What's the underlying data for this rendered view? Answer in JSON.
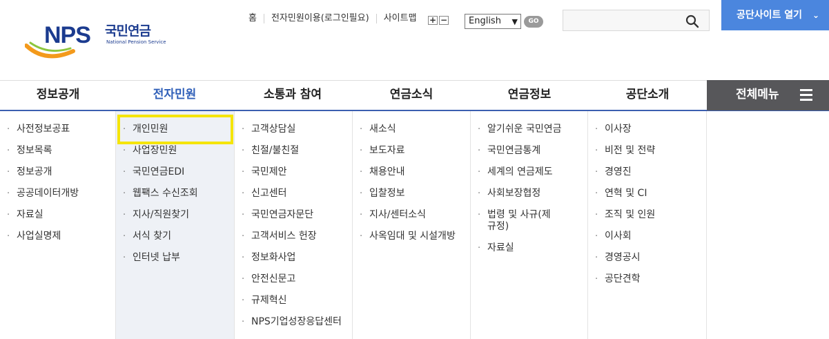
{
  "logo": {
    "nps": "NPS",
    "korean": "국민연금",
    "english": "National Pension Service"
  },
  "utility": {
    "links": [
      "홈",
      "전자민원이용(로그인필요)",
      "사이트맵"
    ],
    "font_plus": "+",
    "font_minus": "−",
    "language_selected": "English",
    "go_label": "GO",
    "search_placeholder": "",
    "open_site_label": "공단사이트 열기"
  },
  "gnb": {
    "menus": [
      "정보공개",
      "전자민원",
      "소통과 참여",
      "연금소식",
      "연금정보",
      "공단소개"
    ],
    "active_index": 1,
    "all_menu_label": "전체메뉴"
  },
  "submenus": [
    [
      "사전정보공표",
      "정보목록",
      "정보공개",
      "공공데이터개방",
      "자료실",
      "사업실명제"
    ],
    [
      "개인민원",
      "사업장민원",
      "국민연금EDI",
      "웹팩스 수신조회",
      "지사/직원찾기",
      "서식 찾기",
      "인터넷 납부"
    ],
    [
      "고객상담실",
      "친절/불친절",
      "국민제안",
      "신고센터",
      "국민연금자문단",
      "고객서비스 헌장",
      "정보화사업",
      "안전신문고",
      "규제혁신",
      "NPS기업성장응답센터"
    ],
    [
      "새소식",
      "보도자료",
      "채용안내",
      "입찰정보",
      "지사/센터소식",
      "사옥임대 및 시설개방"
    ],
    [
      "알기쉬운 국민연금",
      "국민연금통계",
      "세계의 연금제도",
      "사회보장협정",
      "법령 및 사규(제규정)",
      "자료실"
    ],
    [
      "이사장",
      "비전 및 전략",
      "경영진",
      "연혁 및 CI",
      "조직 및 인원",
      "이사회",
      "경영공시",
      "공단견학"
    ]
  ],
  "colors": {
    "accent_blue": "#2f5fb8",
    "button_blue": "#4b86de",
    "highlight_yellow": "#f5e50a",
    "all_menu_bg": "#57575a"
  }
}
